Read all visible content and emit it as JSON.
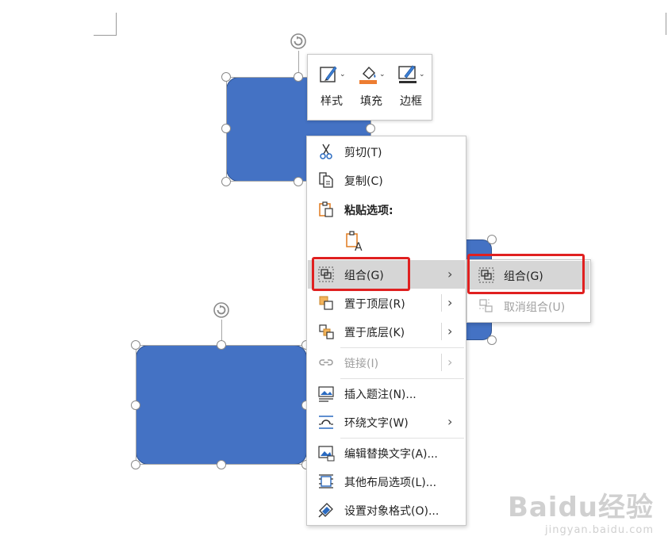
{
  "mini_toolbar": {
    "style_label": "样式",
    "fill_label": "填充",
    "border_label": "边框"
  },
  "context_menu": {
    "items": [
      {
        "label": "剪切(T)",
        "icon": "scissors-icon"
      },
      {
        "label": "复制(C)",
        "icon": "copy-icon"
      },
      {
        "label": "粘贴选项:",
        "icon": "paste-icon"
      },
      {
        "label": "",
        "icon": "paste-keep-text-icon"
      },
      {
        "label": "组合(G)",
        "icon": "group-icon",
        "has_submenu": true,
        "highlighted": true
      },
      {
        "label": "置于顶层(R)",
        "icon": "bring-to-front-icon",
        "has_submenu": true
      },
      {
        "label": "置于底层(K)",
        "icon": "send-to-back-icon",
        "has_submenu": true
      },
      {
        "label": "链接(I)",
        "icon": "link-icon",
        "has_submenu": true,
        "disabled": true
      },
      {
        "label": "插入题注(N)...",
        "icon": "insert-caption-icon"
      },
      {
        "label": "环绕文字(W)",
        "icon": "wrap-text-icon",
        "has_submenu": true
      },
      {
        "label": "编辑替换文字(A)...",
        "icon": "alt-text-icon"
      },
      {
        "label": "其他布局选项(L)...",
        "icon": "layout-options-icon"
      },
      {
        "label": "设置对象格式(O)...",
        "icon": "format-object-icon"
      }
    ]
  },
  "submenu": {
    "items": [
      {
        "label": "组合(G)",
        "icon": "group-icon",
        "highlighted": true
      },
      {
        "label": "取消组合(U)",
        "icon": "ungroup-icon",
        "disabled": true
      }
    ]
  },
  "watermark": {
    "brand": "Baidu经验",
    "url": "jingyan.baidu.com"
  },
  "colors": {
    "shape_fill": "#4472C4",
    "highlight": "#D6D6D6",
    "annotation_red": "#E02020"
  }
}
